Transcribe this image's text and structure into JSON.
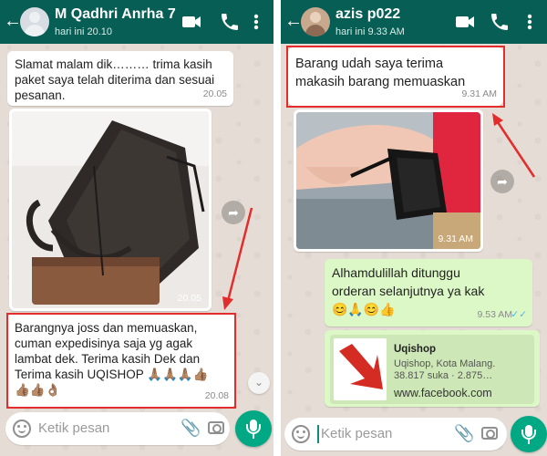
{
  "left_chat": {
    "contact_name": "M Qadhri Anrha 7",
    "last_seen": "hari ini 20.10",
    "messages": [
      {
        "text": "Slamat malam dik……… trima kasih\npaket saya telah diterima dan sesuai\npesanan.",
        "time": "20.05"
      },
      {
        "image_time": "20.05"
      },
      {
        "text": "Barangnya joss dan memuaskan,\ncuman expedisinya saja yg agak\nlambat dek. Terima kasih Dek dan\nTerima kasih UQISHOP 🙏🏽🙏🏽🙏🏽👍🏽\n👍🏽👍🏽👌🏽",
        "time": "20.08"
      }
    ],
    "input_placeholder": "Ketik pesan"
  },
  "right_chat": {
    "contact_name": "azis p022",
    "last_seen": "hari ini 9.33 AM",
    "messages": [
      {
        "text": "Barang udah saya terima\nmakasih barang memuaskan",
        "time": "9.31 AM"
      },
      {
        "image_time": "9.31 AM"
      },
      {
        "text": "Alhamdulillah ditunggu\norderan selanjutnya ya kak\n😊🙏😊👍",
        "time": "9.53 AM",
        "status": "✓✓"
      }
    ],
    "link_preview": {
      "title": "Uqishop",
      "description": "Uqishop, Kota Malang.\n38.817 suka · 2.875…",
      "url": "www.facebook.com"
    },
    "input_placeholder": "Ketik pesan"
  },
  "colors": {
    "header": "#075e54",
    "chat_background": "#e5ddd5",
    "outgoing_bubble": "#dcf8c6",
    "incoming_bubble": "#ffffff",
    "highlight": "#e32c2c",
    "mic_button": "#00a884"
  },
  "icons": [
    "back-arrow-icon",
    "video-call-icon",
    "phone-icon",
    "menu-dots-icon",
    "forward-icon",
    "emoji-icon",
    "attach-icon",
    "camera-icon",
    "mic-icon",
    "scroll-down-icon"
  ]
}
